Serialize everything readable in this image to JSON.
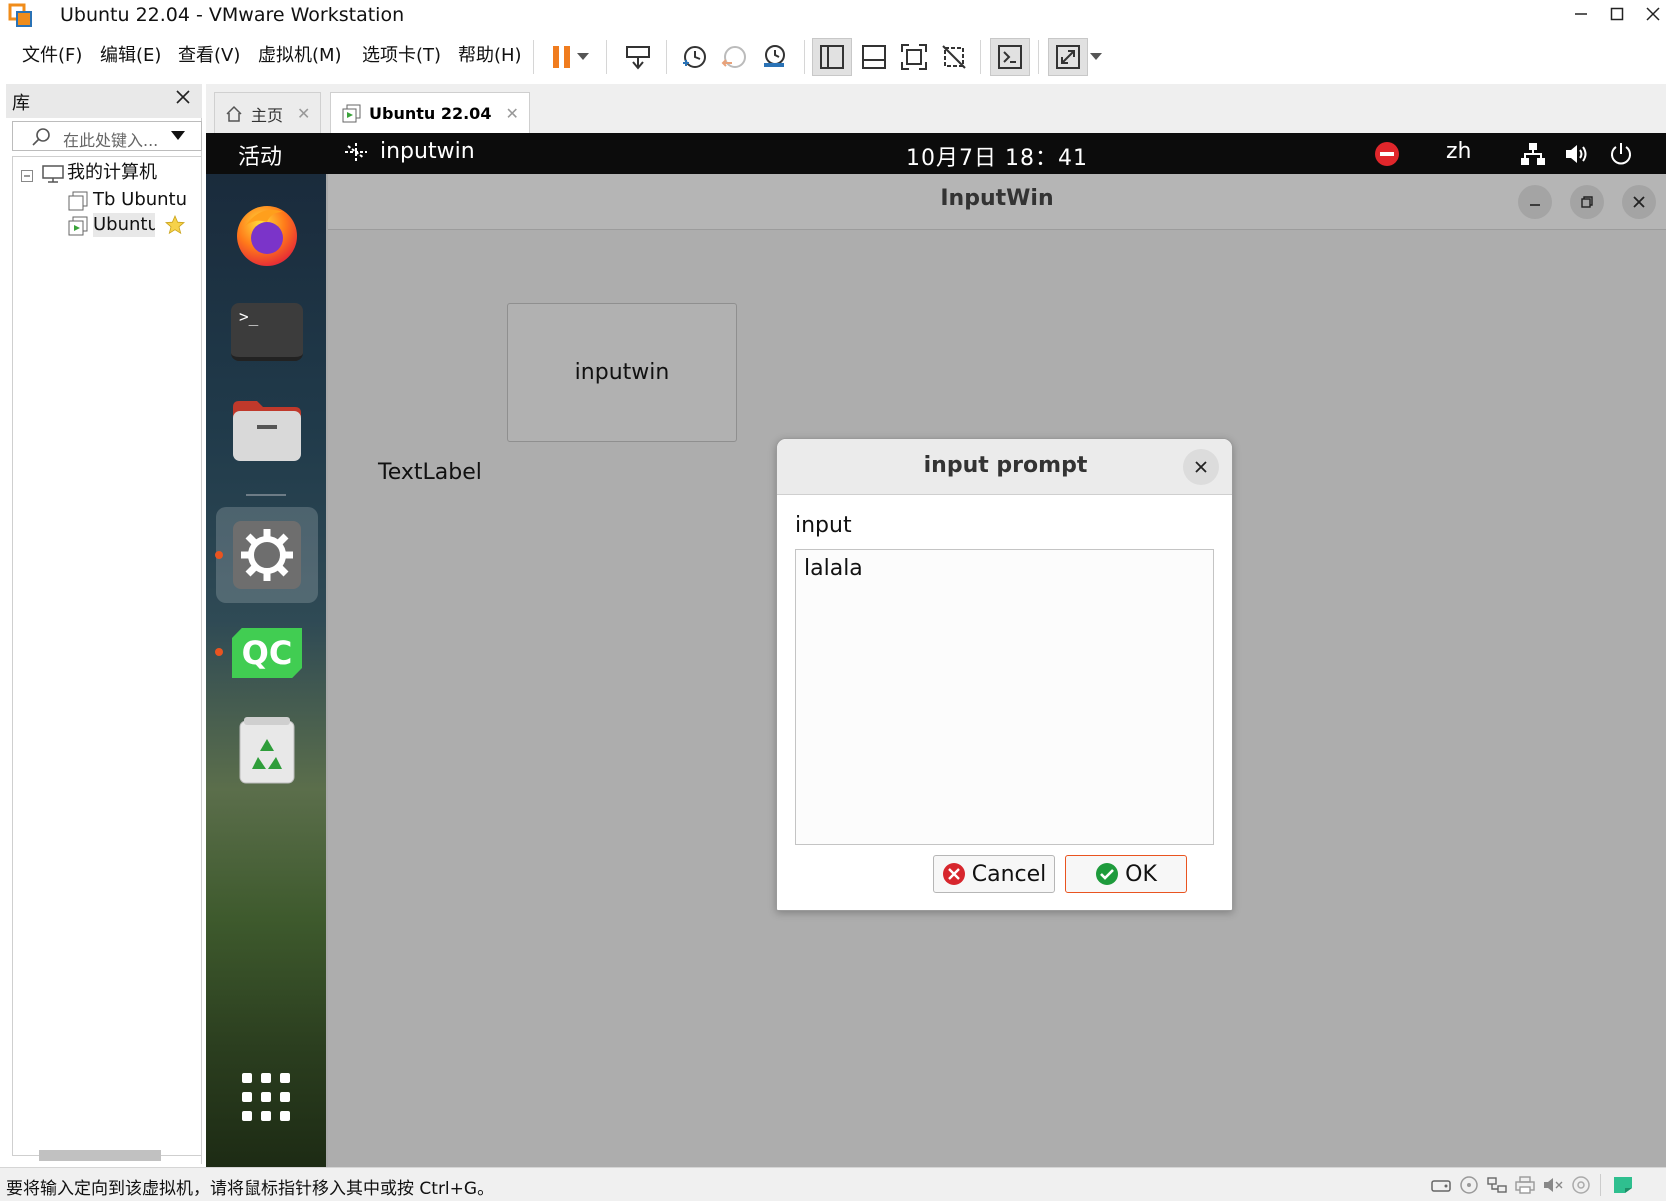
{
  "window": {
    "title": "Ubuntu 22.04 - VMware Workstation",
    "controls": [
      "minimize",
      "maximize",
      "close"
    ]
  },
  "menubar": {
    "items": [
      "文件(F)",
      "编辑(E)",
      "查看(V)",
      "虚拟机(M)",
      "选项卡(T)",
      "帮助(H)"
    ],
    "toolbar_icons": [
      "pause-icon",
      "dropdown-arrow-icon",
      "send-keys-icon",
      "snapshot-icon",
      "revert-snapshot-icon",
      "manage-snapshots-icon",
      "library-view-icon",
      "thumbnail-bar-icon",
      "fullscreen-icon",
      "unity-icon",
      "console-icon",
      "stretch-icon",
      "dropdown-arrow-icon"
    ]
  },
  "library": {
    "title": "库",
    "search_placeholder": "在此处键入...",
    "tree": {
      "root": "我的计算机",
      "children": [
        "Tb Ubuntu",
        "Ubuntu"
      ]
    }
  },
  "tabs": [
    {
      "label": "主页",
      "active": false
    },
    {
      "label": "Ubuntu 22.04",
      "active": true
    }
  ],
  "gnome": {
    "activities": "活动",
    "app_name": "inputwin",
    "clock": "10月7日  18：41",
    "language": "zh"
  },
  "dock": {
    "apps": [
      "firefox-icon",
      "terminal-icon",
      "files-icon",
      "settings-icon",
      "qt-creator-icon",
      "trash-icon",
      "show-apps-icon"
    ],
    "terminal_glyph": ">_",
    "qt_label": "QC"
  },
  "inputwin": {
    "title": "InputWin",
    "button_label": "inputwin",
    "text_label": "TextLabel"
  },
  "dialog": {
    "title": "input prompt",
    "field_label": "input",
    "field_value": "lalala",
    "cancel_label": "Cancel",
    "ok_label": "OK"
  },
  "statusbar": {
    "message": "要将输入定向到该虚拟机，请将鼠标指针移入其中或按 Ctrl+G。"
  },
  "colors": {
    "ubuntu_orange": "#e95420",
    "gnome_bar": "#0c0c0c",
    "vm_background": "#adadad",
    "pause_orange": "#f07c1e"
  }
}
